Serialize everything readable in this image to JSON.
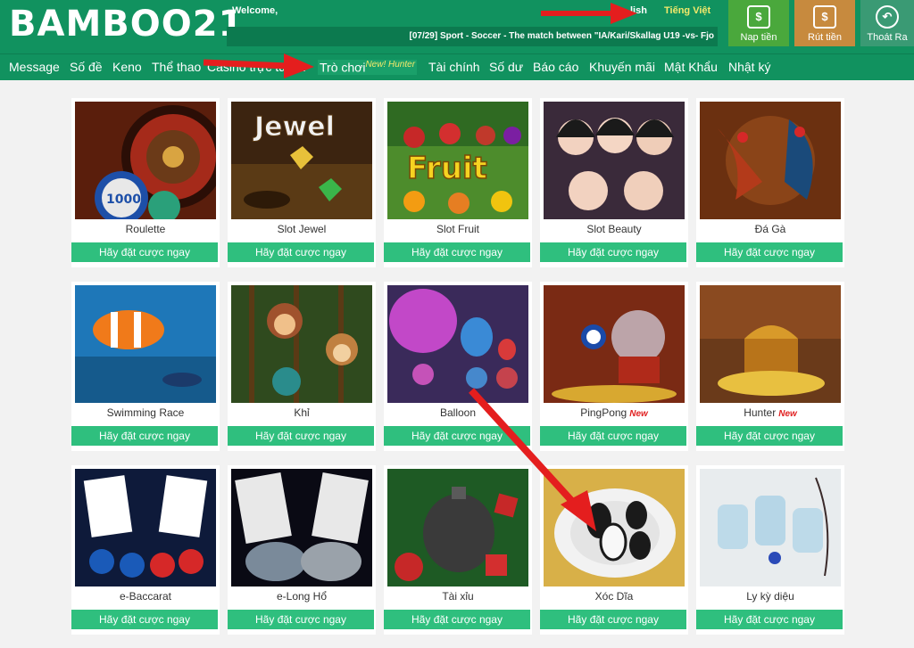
{
  "header": {
    "logo": "BAMBOO21",
    "welcome": "Welcome,",
    "lang_en": "lish",
    "lang_vi": "Tiếng Việt",
    "ticker": "[07/29] Sport - Soccer - The match between \"IA/Kari/Skallag U19 -vs- Fjo",
    "buttons": {
      "deposit": "Nap tiền",
      "withdraw": "Rút tiền",
      "logout": "Thoát Ra"
    }
  },
  "nav": {
    "items": [
      "Message",
      "Số đề",
      "Keno",
      "Thể thao",
      "Casino trực tuyến",
      "Trò chơi",
      "Tài chính",
      "Số dư",
      "Báo cáo",
      "Khuyến mãi",
      "Mật Khẩu",
      "Nhật ký"
    ],
    "active_badge": "New! Hunter"
  },
  "cta": "Hãy đặt cược ngay",
  "new_badge": "New",
  "games": [
    {
      "name": "Roulette",
      "overlay": "1000"
    },
    {
      "name": "Slot Jewel",
      "overlay": "Jewel"
    },
    {
      "name": "Slot Fruit",
      "overlay": "Fruit"
    },
    {
      "name": "Slot Beauty"
    },
    {
      "name": "Đá Gà"
    },
    {
      "name": "Swimming Race"
    },
    {
      "name": "Khỉ"
    },
    {
      "name": "Balloon"
    },
    {
      "name": "PingPong",
      "new": true
    },
    {
      "name": "Hunter",
      "new": true
    },
    {
      "name": "e-Baccarat"
    },
    {
      "name": "e-Long Hổ"
    },
    {
      "name": "Tài xỉu"
    },
    {
      "name": "Xóc Dĩa"
    },
    {
      "name": "Ly kỳ diệu"
    }
  ],
  "colors": {
    "brand": "#11925f",
    "button": "#2fbf7e",
    "accent": "#f3e96b",
    "arrow": "#e41e1e"
  }
}
